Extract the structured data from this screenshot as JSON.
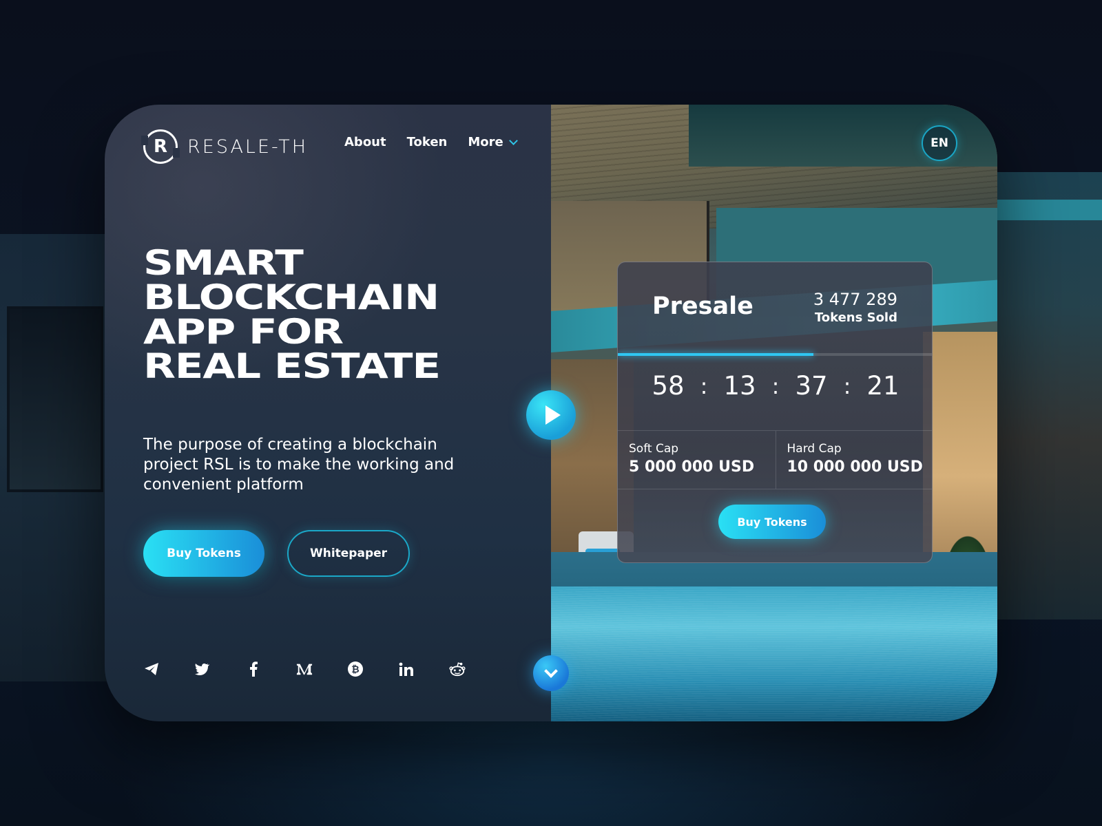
{
  "brand": {
    "logo_letter": "R",
    "name": "RESALE-TH"
  },
  "nav": {
    "items": [
      "About",
      "Token",
      "More"
    ]
  },
  "language": "EN",
  "hero": {
    "title_lines": [
      "SMART",
      "BLOCKCHAIN",
      "APP FOR",
      "REAL ESTATE"
    ],
    "description": "The purpose of creating a blockchain project RSL is to make the working and convenient platform",
    "primary_button": "Buy Tokens",
    "secondary_button": "Whitepaper"
  },
  "socials": [
    "telegram-icon",
    "twitter-icon",
    "facebook-icon",
    "medium-icon",
    "bitcoin-icon",
    "linkedin-icon",
    "reddit-icon"
  ],
  "presale": {
    "title": "Presale",
    "tokens_sold": "3 477 289",
    "tokens_sold_label": "Tokens Sold",
    "progress": 0.62,
    "countdown": [
      "58",
      "13",
      "37",
      "21"
    ],
    "separator": ":",
    "soft_cap_label": "Soft Cap",
    "soft_cap_value": "5 000 000 USD",
    "hard_cap_label": "Hard Cap",
    "hard_cap_value": "10 000 000 USD",
    "button": "Buy Tokens"
  },
  "colors": {
    "accent": "#2ec6e8",
    "accent_dark": "#1a8ed8",
    "panel": "#283446"
  }
}
